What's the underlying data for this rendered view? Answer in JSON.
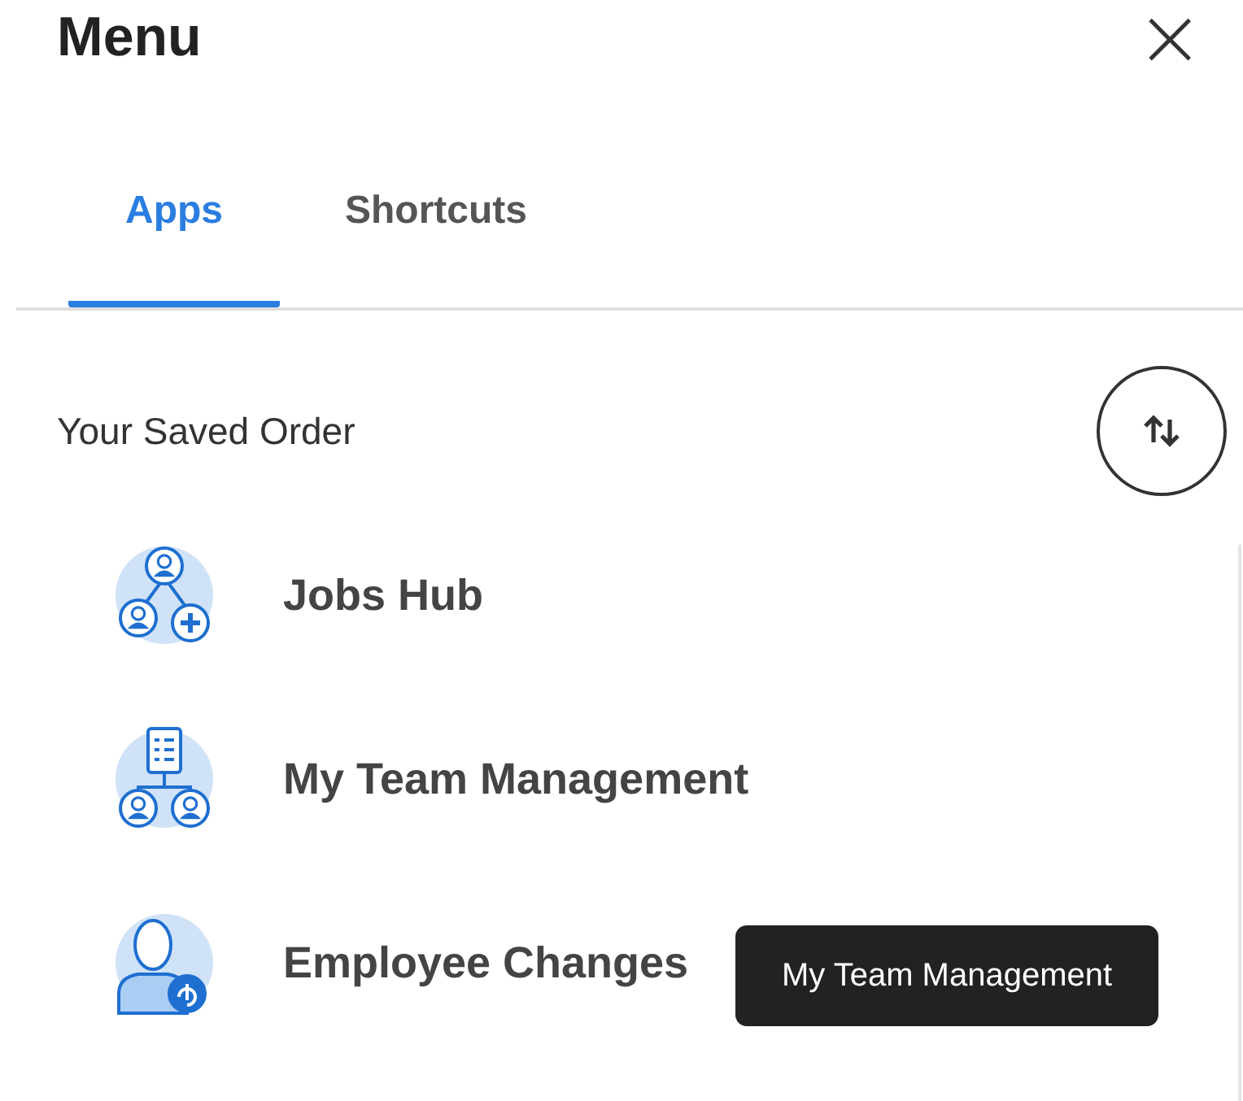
{
  "header": {
    "title": "Menu",
    "close": "×"
  },
  "tabs": [
    {
      "label": "Apps",
      "selected": true
    },
    {
      "label": "Shortcuts",
      "selected": false
    }
  ],
  "section": {
    "title": "Your Saved Order"
  },
  "apps": [
    {
      "label": "Jobs Hub",
      "kind": "org-add"
    },
    {
      "label": "My Team Management",
      "kind": "team-doc"
    },
    {
      "label": "Employee Changes",
      "kind": "person-change"
    }
  ],
  "tooltip": {
    "text": "My Team Management"
  }
}
